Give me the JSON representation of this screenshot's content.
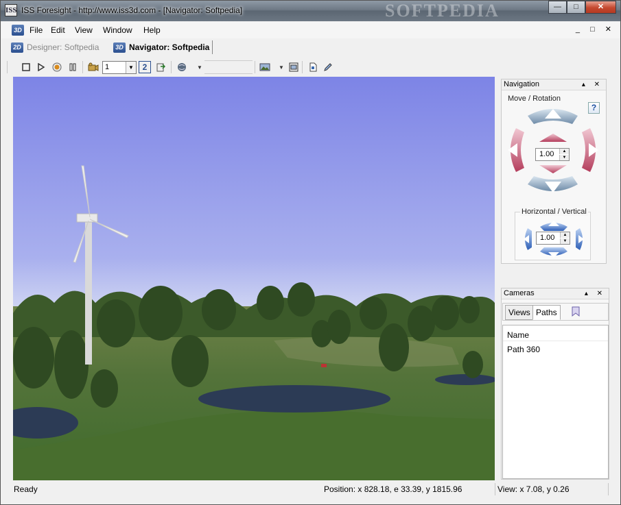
{
  "window": {
    "app_icon": "iss-icon",
    "title": "ISS Foresight - http://www.iss3d.com - [Navigator: Softpedia]",
    "watermark": "SOFTPEDIA",
    "minimize": "—",
    "maximize": "□",
    "close": "✕"
  },
  "menubar": {
    "app_icon_label": "3D",
    "items": [
      "File",
      "Edit",
      "View",
      "Window",
      "Help"
    ],
    "mdi_controls": "_ □ ✕"
  },
  "tabs": [
    {
      "icon": "2D",
      "label": "Designer: Softpedia",
      "active": false
    },
    {
      "icon": "3D",
      "label": "Navigator: Softpedia",
      "active": true
    }
  ],
  "toolbar": {
    "camera_select_value": "1",
    "icons": [
      "stop-icon",
      "play-icon",
      "record-icon",
      "pause-icon",
      "camera-icon",
      "two-icon",
      "export-icon",
      "globe-icon",
      "picture-icon",
      "frame-icon",
      "page-icon",
      "pen-icon"
    ],
    "two_label": "2"
  },
  "navigation_panel": {
    "title": "Navigation",
    "panel_controls": "▴ ✕",
    "move_rotation_label": "Move / Rotation",
    "move_rotation_value": "1.00",
    "horizontal_vertical_label": "Horizontal / Vertical",
    "horizontal_vertical_value": "1.00",
    "help_label": "?"
  },
  "cameras_panel": {
    "title": "Cameras",
    "panel_controls": "▴ ✕",
    "tabs": [
      "Views",
      "Paths"
    ],
    "selected_tab": "Paths",
    "column_header": "Name",
    "rows": [
      "Path 360"
    ]
  },
  "status": {
    "state": "Ready",
    "position": "Position: x 828.18, e 33.39, y 1815.96",
    "view": "View: x 7.08, y 0.26"
  },
  "colors": {
    "sky_top": "#7f86e8",
    "sky_bottom": "#dfe4f3",
    "grass": "#4f6e2f",
    "water": "#2c3b55",
    "arrow_red": "#c04a63",
    "arrow_grey": "#7f9bb3",
    "arrow_blue": "#2e5fb6"
  }
}
